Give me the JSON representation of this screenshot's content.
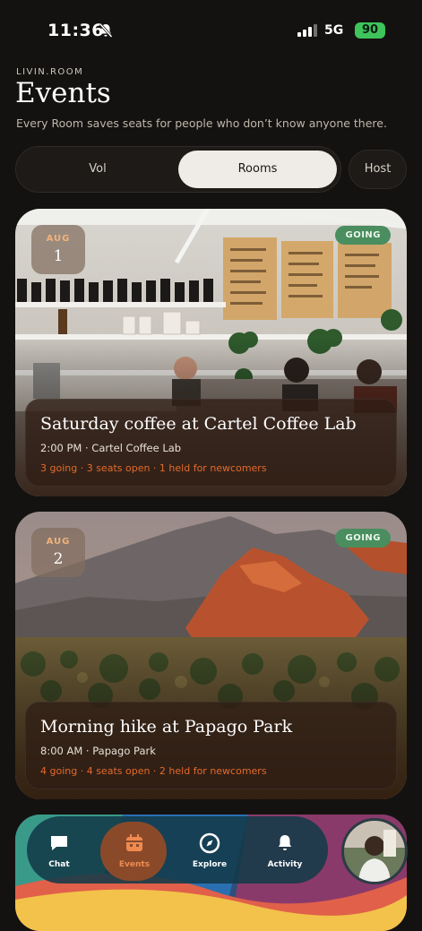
{
  "status": {
    "time": "11:36",
    "network": "5G",
    "battery": "90"
  },
  "header": {
    "eyebrow": "LIVIN.ROOM",
    "title": "Events",
    "subtitle": "Every Room saves seats for people who don’t know anyone there."
  },
  "segments": {
    "options": [
      "Vol",
      "Rooms"
    ],
    "selected": "Rooms",
    "host": "Host"
  },
  "events": [
    {
      "month": "AUG",
      "day": "1",
      "status": "GOING",
      "title": "Saturday coffee at Cartel Coffee Lab",
      "time": "2:00 PM · Cartel Coffee Lab",
      "stats": "3 going · 3 seats open · 1 held for newcomers"
    },
    {
      "month": "AUG",
      "day": "2",
      "status": "GOING",
      "title": "Morning hike at Papago Park",
      "time": "8:00 AM · Papago Park",
      "stats": "4 going · 4 seats open · 2 held for newcomers"
    }
  ],
  "tabbar": {
    "tabs": [
      {
        "label": "Chat",
        "icon": "chat-icon"
      },
      {
        "label": "Events",
        "icon": "calendar-icon",
        "active": true
      },
      {
        "label": "Explore",
        "icon": "compass-icon"
      },
      {
        "label": "Activity",
        "icon": "bell-icon"
      }
    ]
  },
  "colors": {
    "accent": "#e46a2b",
    "going": "#4a8d5e",
    "background": "#141210"
  }
}
